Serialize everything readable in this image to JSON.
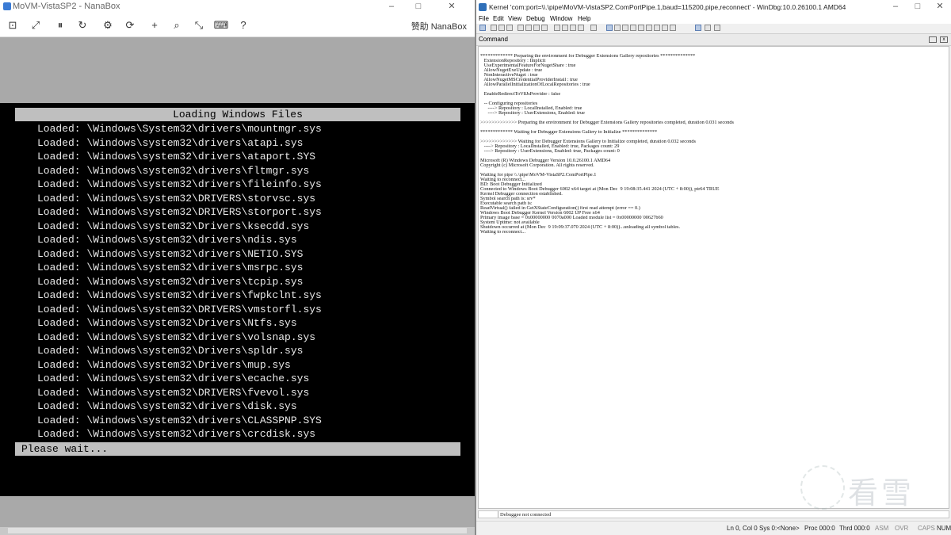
{
  "left_window": {
    "title": "MoVM-VistaSP2 - NanaBox",
    "controls": {
      "minimize": "–",
      "maximize": "□",
      "close": "✕"
    },
    "toolbar": {
      "buttons": [
        {
          "name": "enhanced-session-icon",
          "glyph": "⊡"
        },
        {
          "name": "fullscreen-icon",
          "glyph": "⤢"
        },
        {
          "name": "pause-icon",
          "glyph": "⏸"
        },
        {
          "name": "restart-icon",
          "glyph": "↻"
        },
        {
          "name": "settings-icon",
          "glyph": "⚙"
        },
        {
          "name": "reset-icon",
          "glyph": "⟳"
        },
        {
          "name": "zoom-in-icon",
          "glyph": "+"
        },
        {
          "name": "search-icon",
          "glyph": "⌕"
        },
        {
          "name": "zoom-fit-icon",
          "glyph": "⤡"
        },
        {
          "name": "ctrl-alt-del-icon",
          "glyph": "⌨"
        },
        {
          "name": "help-icon",
          "glyph": "?"
        }
      ],
      "sponsor_label": "赞助 NanaBox"
    },
    "boot_screen": {
      "header": "Loading Windows Files",
      "lines": [
        "Loaded: \\Windows\\System32\\drivers\\mountmgr.sys",
        "Loaded: \\Windows\\system32\\drivers\\atapi.sys",
        "Loaded: \\Windows\\system32\\drivers\\ataport.SYS",
        "Loaded: \\Windows\\system32\\drivers\\fltmgr.sys",
        "Loaded: \\Windows\\system32\\drivers\\fileinfo.sys",
        "Loaded: \\Windows\\system32\\DRIVERS\\storvsc.sys",
        "Loaded: \\Windows\\system32\\DRIVERS\\storport.sys",
        "Loaded: \\Windows\\system32\\Drivers\\ksecdd.sys",
        "Loaded: \\Windows\\system32\\drivers\\ndis.sys",
        "Loaded: \\Windows\\system32\\drivers\\NETIO.SYS",
        "Loaded: \\Windows\\system32\\drivers\\msrpc.sys",
        "Loaded: \\Windows\\system32\\drivers\\tcpip.sys",
        "Loaded: \\Windows\\system32\\drivers\\fwpkclnt.sys",
        "Loaded: \\Windows\\system32\\DRIVERS\\vmstorfl.sys",
        "Loaded: \\Windows\\system32\\Drivers\\Ntfs.sys",
        "Loaded: \\Windows\\system32\\drivers\\volsnap.sys",
        "Loaded: \\Windows\\system32\\Drivers\\spldr.sys",
        "Loaded: \\Windows\\system32\\Drivers\\mup.sys",
        "Loaded: \\Windows\\system32\\drivers\\ecache.sys",
        "Loaded: \\Windows\\system32\\DRIVERS\\fvevol.sys",
        "Loaded: \\Windows\\system32\\drivers\\disk.sys",
        "Loaded: \\Windows\\system32\\drivers\\CLASSPNP.SYS",
        "Loaded: \\Windows\\system32\\drivers\\crcdisk.sys"
      ],
      "footer": "Please wait..."
    }
  },
  "right_window": {
    "title": "Kernel 'com:port=\\\\.\\pipe\\MoVM-VistaSP2.ComPortPipe.1,baud=115200,pipe,reconnect' - WinDbg:10.0.26100.1 AMD64",
    "controls": {
      "minimize": "–",
      "maximize": "□",
      "close": "✕"
    },
    "menu": [
      "File",
      "Edit",
      "View",
      "Debug",
      "Window",
      "Help"
    ],
    "command_pane_title": "Command",
    "command_lines": [
      "************* Preparing the environment for Debugger Extensions Gallery repositories **************",
      "   ExtensionRepository : Implicit",
      "   UseExperimentalFeatureForNugetShare : true",
      "   AllowNugetExeUpdate : true",
      "   NonInteractiveNuget : true",
      "   AllowNugetMSCredentialProviderInstall : true",
      "   AllowParallelInitializationOfLocalRepositories : true",
      "",
      "   EnableRedirectToV8JsProvider : false",
      "",
      "   -- Configuring repositories",
      "      ----> Repository : LocalInstalled, Enabled: true",
      "      ----> Repository : UserExtensions, Enabled: true",
      "",
      ">>>>>>>>>>>>> Preparing the environment for Debugger Extensions Gallery repositories completed, duration 0.031 seconds",
      "",
      "************* Waiting for Debugger Extensions Gallery to Initialize **************",
      "",
      ">>>>>>>>>>>>> Waiting for Debugger Extensions Gallery to Initialize completed, duration 0.032 seconds",
      "   ----> Repository : LocalInstalled, Enabled: true, Packages count: 29",
      "   ----> Repository : UserExtensions, Enabled: true, Packages count: 0",
      "",
      "Microsoft (R) Windows Debugger Version 10.0.26100.1 AMD64",
      "Copyright (c) Microsoft Corporation. All rights reserved.",
      "",
      "Waiting for pipe \\\\.\\pipe\\MoVM-VistaSP2.ComPortPipe.1",
      "Waiting to reconnect...",
      "BD: Boot Debugger Initialized",
      "Connected to Windows Boot Debugger 6002 x64 target at (Mon Dec  9 19:08:35.441 2024 (UTC + 8:00)), ptr64 TRUE",
      "Kernel Debugger connection established.",
      "Symbol search path is: srv*",
      "Executable search path is:",
      "ReadVirtual() failed in GetXStateConfiguration() first read attempt (error == 0.)",
      "Windows Boot Debugger Kernel Version 6002 UP Free x64",
      "Primary image base = 0x00000000`0070a000 Loaded module list = 0x00000000`00627b60",
      "System Uptime: not available",
      "Shutdown occurred at (Mon Dec  9 19:09:37.070 2024 (UTC + 8:00))...unloading all symbol tables.",
      "Waiting to reconnect..."
    ],
    "command_input_text": "Debuggee not connected",
    "status": {
      "ln_col": "Ln 0, Col 0",
      "sys": "Sys 0:<None>",
      "proc": "Proc 000:0",
      "thrd": "Thrd 000:0",
      "asm": "ASM",
      "ovr": "OVR",
      "caps": "CAPS",
      "num": "NUM"
    }
  },
  "watermark": {
    "text": "看雪"
  },
  "colors": {
    "boot_background": "#000000",
    "boot_bar": "#bfbfbf",
    "vm_background": "#a9a9a9",
    "window_chrome": "#f0f0f0"
  }
}
